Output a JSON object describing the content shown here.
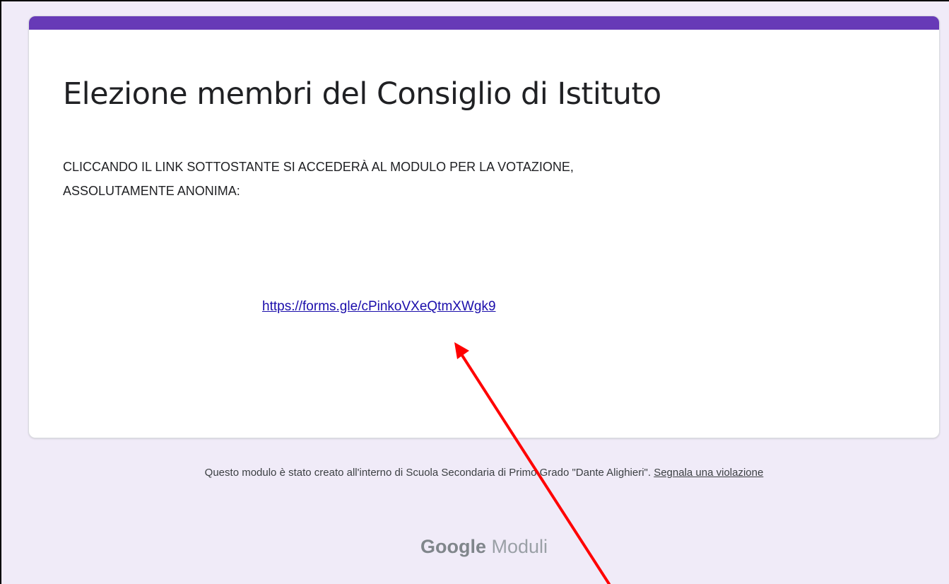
{
  "colors": {
    "accent": "#673ab7",
    "background": "#f0ebf8",
    "link": "#1a0dab",
    "annotation_arrow": "#ff0000"
  },
  "form": {
    "title": "Elezione membri del Consiglio di Istituto",
    "description_line1": "CLICCANDO IL LINK SOTTOSTANTE SI ACCEDERÀ AL MODULO PER LA VOTAZIONE,",
    "description_line2": "ASSOLUTAMENTE ANONIMA:",
    "link": "https://forms.gle/cPinkoVXeQtmXWgk9"
  },
  "footer": {
    "notice": "Questo modulo è stato creato all'interno di Scuola Secondaria di Primo Grado \"Dante Alighieri\". ",
    "report_link_label": "Segnala una violazione"
  },
  "logo": {
    "brand": "Google",
    "product": "Moduli"
  }
}
